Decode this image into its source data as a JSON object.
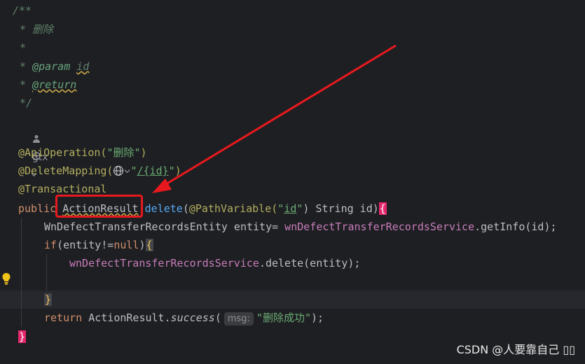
{
  "code": {
    "doc_open": "/**",
    "doc_desc": "* 删除",
    "doc_blank": "*",
    "doc_star": "*",
    "doc_param_tag": "@param",
    "doc_param_name": "id",
    "doc_return_tag": "@return",
    "doc_close": "*/",
    "author": "gtx",
    "ann_api": "@ApiOperation(",
    "ann_api_str": "\"删除\"",
    "ann_api_close": ")",
    "ann_delete": "@DeleteMapping(",
    "ann_delete_str_q1": "\"",
    "ann_delete_path": "/{id}",
    "ann_delete_str_q2": "\"",
    "ann_delete_close": ")",
    "ann_tx": "@Transactional",
    "kw_public": "public",
    "type_actionresult": "ActionResult",
    "method_delete": "delete",
    "param_open": "(",
    "ann_pathvar": "@PathVariable(",
    "pathvar_q1": "\"",
    "pathvar_id": "id",
    "pathvar_q2": "\"",
    "param_rest": ") String id)",
    "brace_open": "{",
    "line1_type": "WnDefectTransferRecordsEntity entity= ",
    "line1_service": "wnDefectTransferRecordsService",
    "line1_call": ".getInfo(id);",
    "kw_if": "if",
    "if_cond": "(entity!=",
    "kw_null": "null",
    "if_close": ")",
    "if_brace": "{",
    "line2_service": "wnDefectTransferRecordsService",
    "line2_call": ".delete(entity);",
    "inner_close": "}",
    "kw_return": "return",
    "return_obj": " ActionResult.",
    "return_method": "success",
    "return_open": "(",
    "return_hint": "msg:",
    "return_str": "\"删除成功\"",
    "return_close": ");",
    "outer_close": "}"
  },
  "watermark": "CSDN @人要靠自己    ▯▯"
}
